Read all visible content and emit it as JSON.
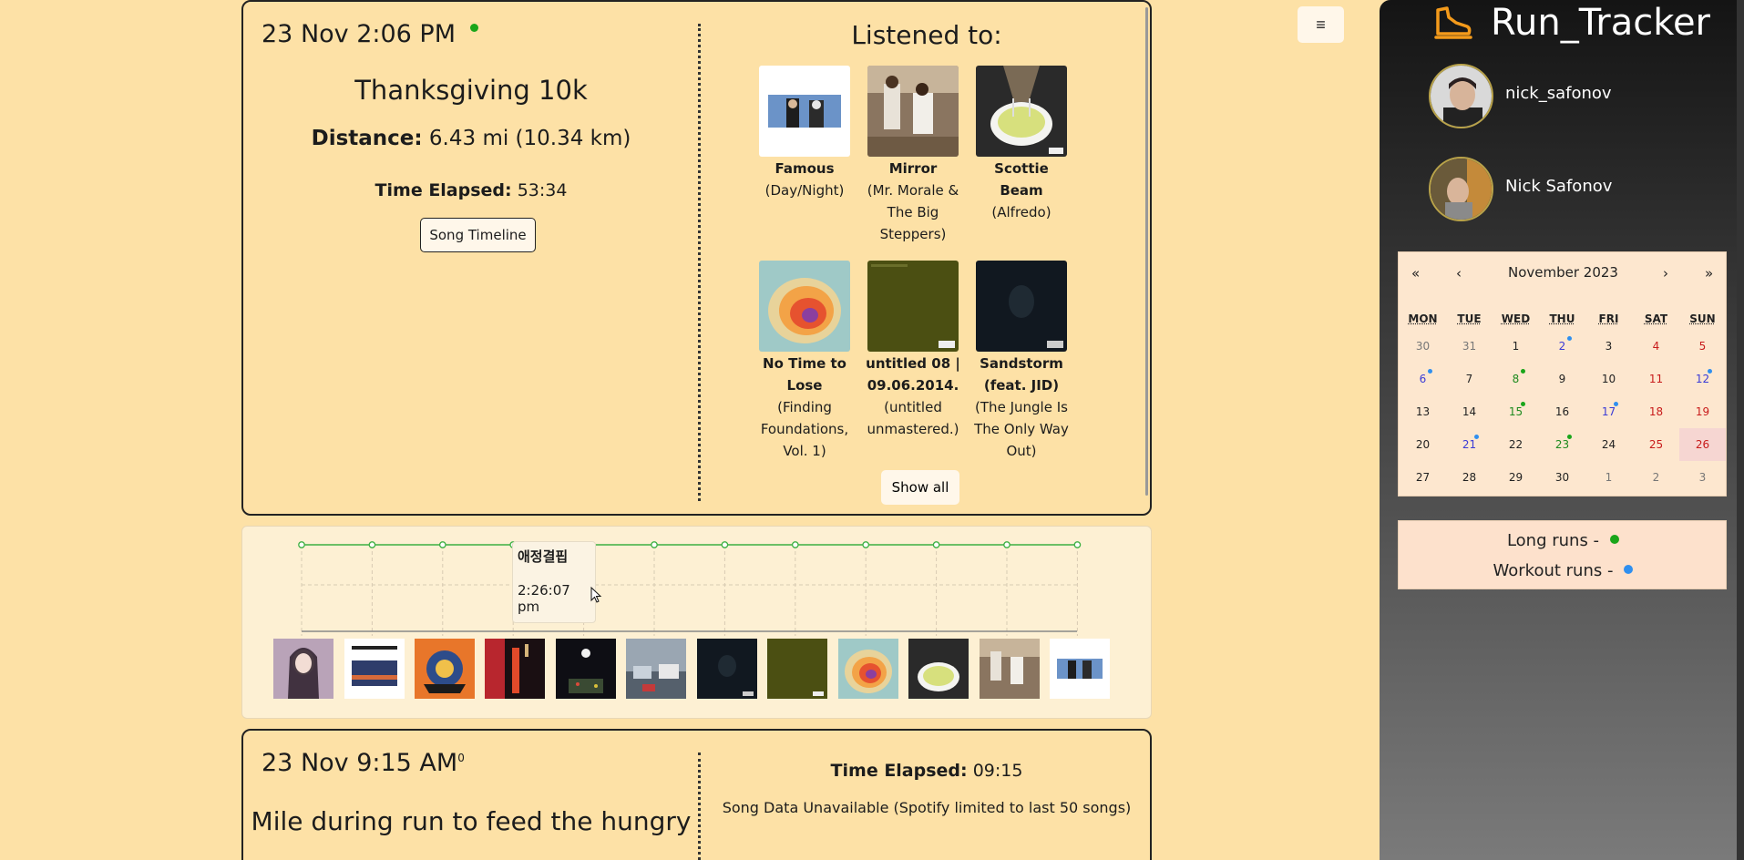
{
  "run1": {
    "date": "23 Nov 2:06 PM",
    "title": "Thanksgiving 10k",
    "distance_label": "Distance:",
    "distance_value": "6.43 mi (10.34 km)",
    "elapsed_label": "Time Elapsed:",
    "elapsed_value": "53:34",
    "timeline_button": "Song Timeline",
    "listened_title": "Listened to:",
    "songs": [
      {
        "name": "Famous",
        "album": "(Day/Night)"
      },
      {
        "name": "Mirror",
        "album": "(Mr. Morale & The Big Steppers)"
      },
      {
        "name": "Scottie Beam",
        "album": "(Alfredo)"
      },
      {
        "name": "No Time to Lose",
        "album": "(Finding Foundations, Vol. 1)"
      },
      {
        "name": "untitled 08 | 09.06.2014.",
        "album": "(untitled unmastered.)"
      },
      {
        "name": "Sandstorm (feat. JID)",
        "album": "(The Jungle Is The Only Way Out)"
      }
    ],
    "show_all_button": "Show all",
    "status_color": "#1aa51a"
  },
  "timeline": {
    "tooltip_title": "애정결핍",
    "tooltip_time": "2:26:07 pm",
    "line_color": "#3cb043",
    "thumb_count": 12
  },
  "run2": {
    "date": "23 Nov 9:15 AM",
    "date_sup": "0",
    "title": "Mile during run to feed the hungry",
    "elapsed_label": "Time Elapsed:",
    "elapsed_value": "09:15",
    "song_note": "Song Data Unavailable (Spotify limited to last 50 songs)"
  },
  "menu_button": "≡",
  "sidebar": {
    "brand": "Run_Tracker",
    "users": [
      {
        "name": "nick_safonov"
      },
      {
        "name": "Nick Safonov"
      }
    ],
    "calendar": {
      "nav_first": "«",
      "nav_prev": "‹",
      "month": "November 2023",
      "nav_next": "›",
      "nav_last": "»",
      "weekdays": [
        "MON",
        "TUE",
        "WED",
        "THU",
        "FRI",
        "SAT",
        "SUN"
      ],
      "weeks": [
        [
          "30",
          "31",
          "1",
          "2",
          "3",
          "4",
          "5"
        ],
        [
          "6",
          "7",
          "8",
          "9",
          "10",
          "11",
          "12"
        ],
        [
          "13",
          "14",
          "15",
          "16",
          "17",
          "18",
          "19"
        ],
        [
          "20",
          "21",
          "22",
          "23",
          "24",
          "25",
          "26"
        ],
        [
          "27",
          "28",
          "29",
          "30",
          "1",
          "2",
          "3"
        ]
      ]
    },
    "legend": {
      "long_runs": "Long runs -",
      "workout_runs": "Workout runs -",
      "long_color": "#1aa51a",
      "workout_color": "#2f8fef"
    }
  }
}
